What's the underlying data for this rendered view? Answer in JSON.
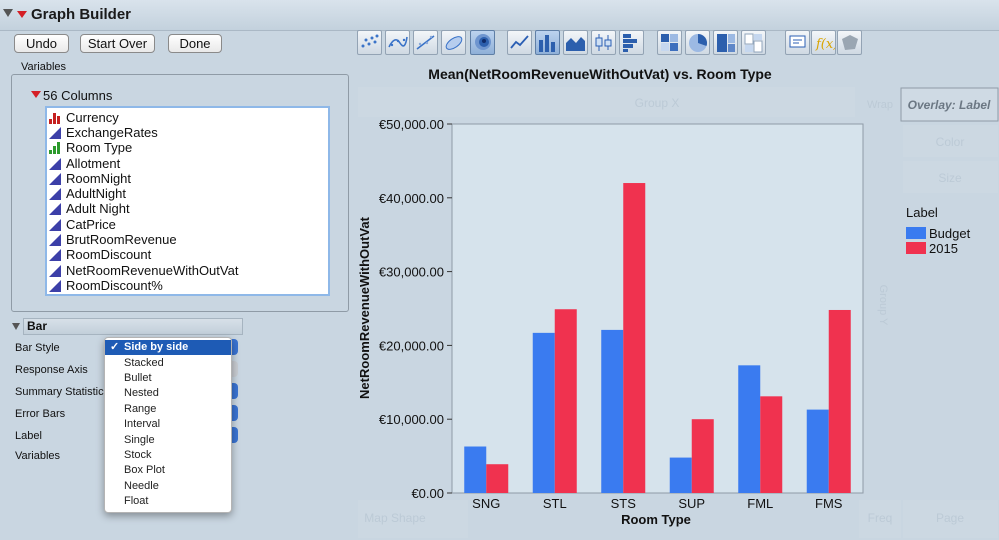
{
  "window": {
    "title": "Graph Builder"
  },
  "buttons": {
    "undo": "Undo",
    "start_over": "Start Over",
    "done": "Done"
  },
  "variables": {
    "label": "Variables",
    "columns_label": "56 Columns",
    "columns": [
      {
        "name": "Currency",
        "icon": "nominal-bar-icon"
      },
      {
        "name": "ExchangeRates",
        "icon": "continuous-icon"
      },
      {
        "name": "Room Type",
        "icon": "ordinal-bar-icon"
      },
      {
        "name": "Allotment",
        "icon": "continuous-icon"
      },
      {
        "name": "RoomNight",
        "icon": "continuous-icon"
      },
      {
        "name": "AdultNight",
        "icon": "continuous-icon"
      },
      {
        "name": "Adult Night",
        "icon": "continuous-icon"
      },
      {
        "name": "CatPrice",
        "icon": "continuous-icon"
      },
      {
        "name": "BrutRoomRevenue",
        "icon": "continuous-icon"
      },
      {
        "name": "RoomDiscount",
        "icon": "continuous-icon"
      },
      {
        "name": "NetRoomRevenueWithOutVat",
        "icon": "continuous-icon"
      },
      {
        "name": "RoomDiscount%",
        "icon": "continuous-icon"
      }
    ]
  },
  "bar_panel": {
    "title": "Bar",
    "props": [
      "Bar Style",
      "Response Axis",
      "Summary Statistic",
      "Error Bars",
      "Label",
      "Variables"
    ]
  },
  "bar_style_dropdown": {
    "selected": "Side by side",
    "options": [
      "Side by side",
      "Stacked",
      "Bullet",
      "Nested",
      "Range",
      "Interval",
      "Single",
      "Stock",
      "Box Plot",
      "Needle",
      "Float"
    ]
  },
  "drop_zones": {
    "group_x": "Group X",
    "wrap": "Wrap",
    "overlay": "Overlay: Label",
    "color": "Color",
    "size": "Size",
    "freq": "Freq",
    "page": "Page",
    "map_shape": "Map Shape",
    "group_y": "Group Y"
  },
  "colors": {
    "budget": "#3a7bf0",
    "y2015": "#f0324f",
    "plot_bg": "#d6e3ec"
  },
  "chart_data": {
    "type": "bar",
    "title": "Mean(NetRoomRevenueWithOutVat) vs. Room Type",
    "xlabel": "Room Type",
    "ylabel": "NetRoomRevenueWithOutVat",
    "categories": [
      "SNG",
      "STL",
      "STS",
      "SUP",
      "FML",
      "FMS"
    ],
    "series": [
      {
        "name": "Budget",
        "values": [
          6300,
          21700,
          22100,
          4800,
          17300,
          11300
        ]
      },
      {
        "name": "2015",
        "values": [
          3900,
          24900,
          42000,
          10000,
          13100,
          24800
        ]
      }
    ],
    "ylim": [
      0,
      50000
    ],
    "yticks": [
      0,
      10000,
      20000,
      30000,
      40000,
      50000
    ],
    "ytick_labels": [
      "€0.00",
      "€10,000.00",
      "€20,000.00",
      "€30,000.00",
      "€40,000.00",
      "€50,000.00"
    ],
    "legend_title": "Label",
    "legend_position": "right",
    "grid": false
  }
}
